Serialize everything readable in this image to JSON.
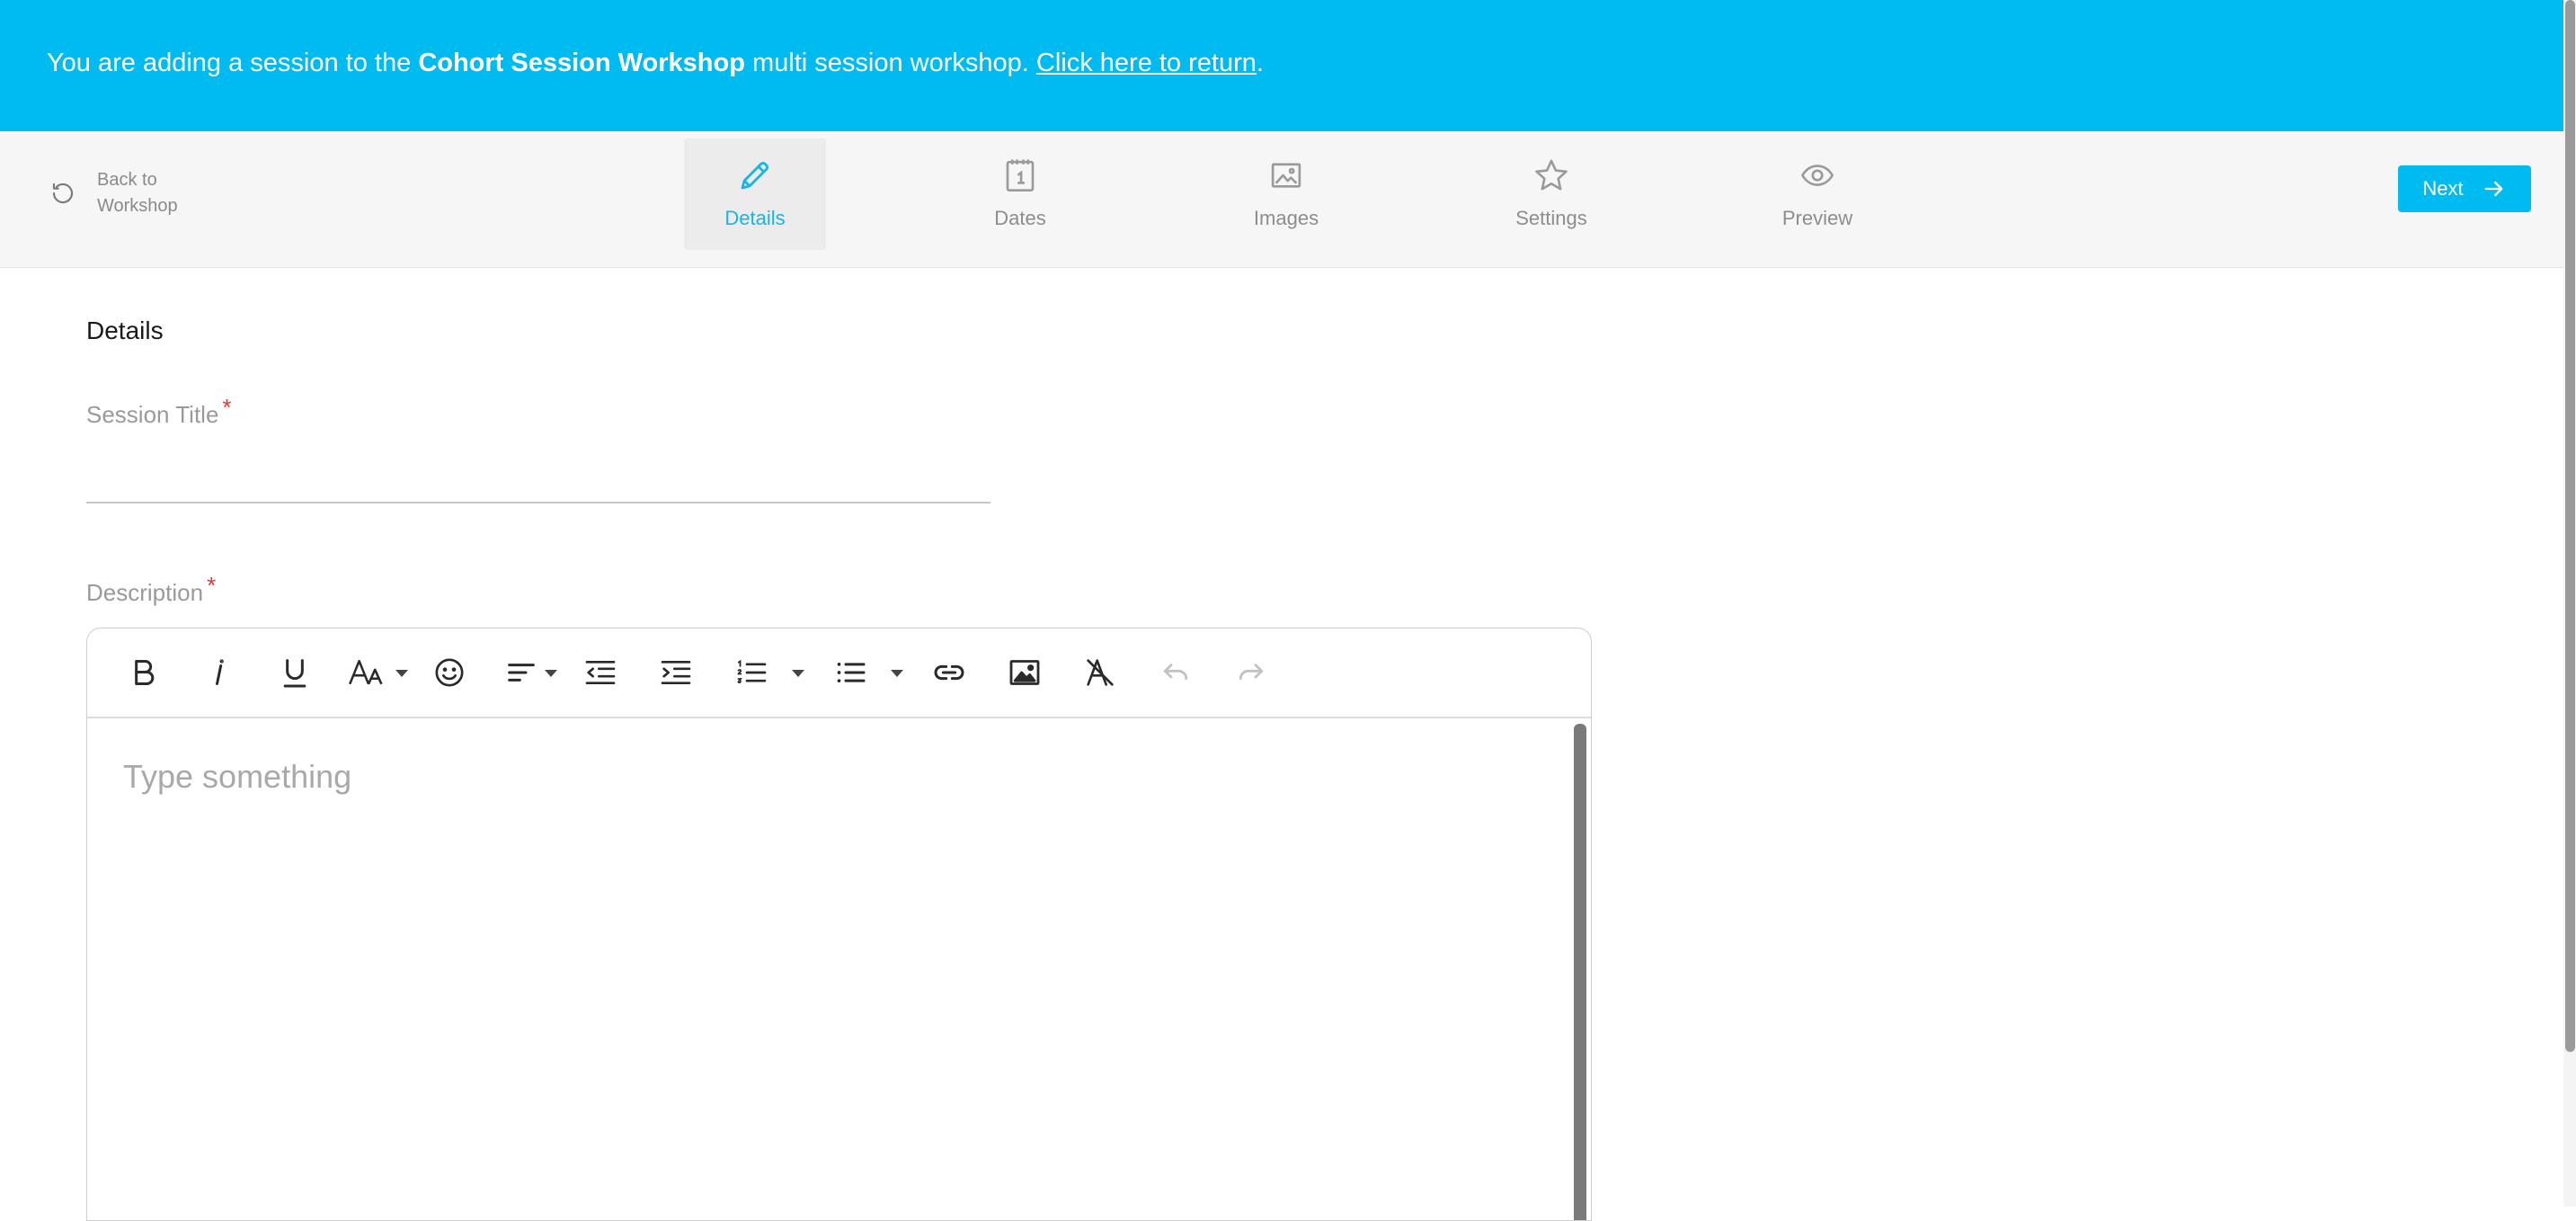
{
  "banner": {
    "prefix": "You are adding a session to the",
    "workshop_name": "Cohort Session Workshop",
    "middle": "multi session workshop.",
    "return_link": "Click here to return",
    "suffix": "."
  },
  "toolbar": {
    "back_label_line1": "Back to",
    "back_label_line2": "Workshop",
    "steps": [
      {
        "label": "Details",
        "icon": "pencil-icon",
        "active": true
      },
      {
        "label": "Dates",
        "icon": "calendar-icon",
        "active": false
      },
      {
        "label": "Images",
        "icon": "image-icon",
        "active": false
      },
      {
        "label": "Settings",
        "icon": "star-icon",
        "active": false
      },
      {
        "label": "Preview",
        "icon": "eye-icon",
        "active": false
      }
    ],
    "next_label": "Next"
  },
  "form": {
    "section_title": "Details",
    "session_title_label": "Session Title",
    "session_title_value": "",
    "required_mark": "*",
    "description_label": "Description",
    "description_placeholder": "Type something"
  },
  "colors": {
    "accent": "#00bbf0",
    "active_step": "#18b4e4",
    "required": "#e53935"
  }
}
